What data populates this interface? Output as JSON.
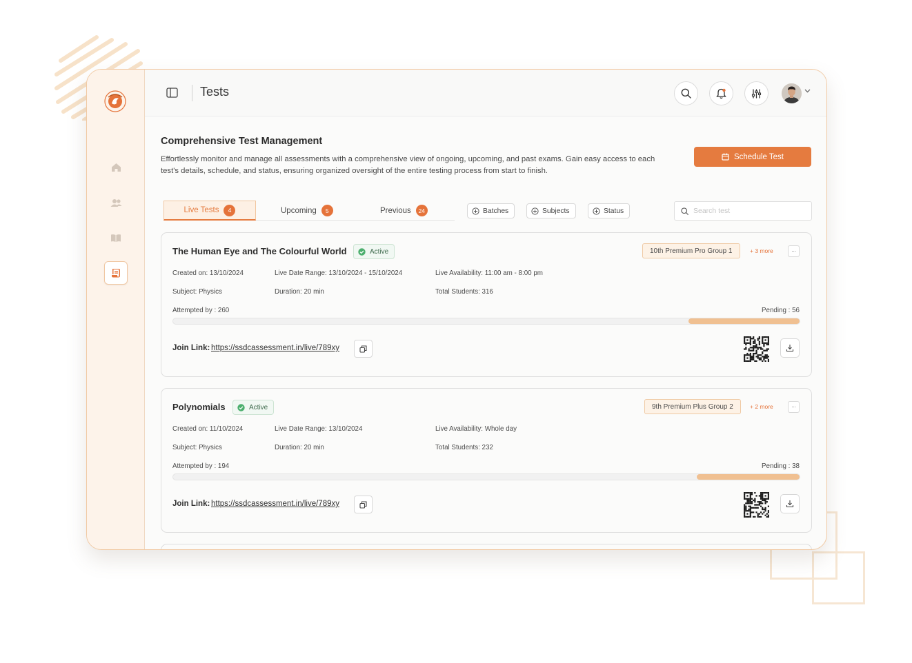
{
  "theme": {
    "accent": "#e57b3f",
    "sidebar_bg": "#fdf3ea",
    "active_green": "#4caf6e"
  },
  "header": {
    "title": "Tests"
  },
  "sidebar": {
    "items": [
      {
        "icon": "home-icon"
      },
      {
        "icon": "users-icon"
      },
      {
        "icon": "book-icon"
      },
      {
        "icon": "scroll-icon",
        "active": true
      }
    ]
  },
  "topbar_actions": {
    "icons": [
      "search-icon",
      "bell-icon",
      "sliders-icon",
      "avatar"
    ]
  },
  "intro": {
    "heading": "Comprehensive Test Management",
    "description": "Effortlessly monitor and manage all assessments with a comprehensive view of ongoing, upcoming, and past exams. Gain easy access to each test's details, schedule, and status, ensuring organized oversight of the entire testing process from start to finish.",
    "schedule_button": "Schedule Test"
  },
  "tabs": [
    {
      "label": "Live Tests",
      "count": "4"
    },
    {
      "label": "Upcoming",
      "count": "5"
    },
    {
      "label": "Previous",
      "count": "24"
    }
  ],
  "filters": [
    "Batches",
    "Subjects",
    "Status"
  ],
  "search": {
    "placeholder": "Search test",
    "value": ""
  },
  "tests": [
    {
      "title": "The Human Eye and The Colourful World",
      "status": "Active",
      "group": "10th Premium Pro Group 1",
      "more": "+ 3 more",
      "created": "Created on: 13/10/2024",
      "date_range": "Live Date Range: 13/10/2024 - 15/10/2024",
      "availability": "Live Availability: 11:00 am - 8:00 pm",
      "subject": "Subject: Physics",
      "duration": "Duration: 20 min",
      "total": "Total Students: 316",
      "attempted": "Attempted by : 260",
      "pending": "Pending : 56",
      "pending_fraction": 0.177,
      "join_label": "Join Link:",
      "join_link": "https://ssdcassessment.in/live/789xy"
    },
    {
      "title": "Polynomials",
      "status": "Active",
      "group": "9th Premium Plus Group 2",
      "more": "+ 2 more",
      "created": "Created on: 11/10/2024",
      "date_range": "Live Date Range: 13/10/2024",
      "availability": "Live Availability: Whole day",
      "subject": "Subject: Physics",
      "duration": "Duration: 20 min",
      "total": "Total Students: 232",
      "attempted": "Attempted by : 194",
      "pending": "Pending : 38",
      "pending_fraction": 0.164,
      "join_label": "Join Link:",
      "join_link": "https://ssdcassessment.in/live/789xy"
    }
  ]
}
